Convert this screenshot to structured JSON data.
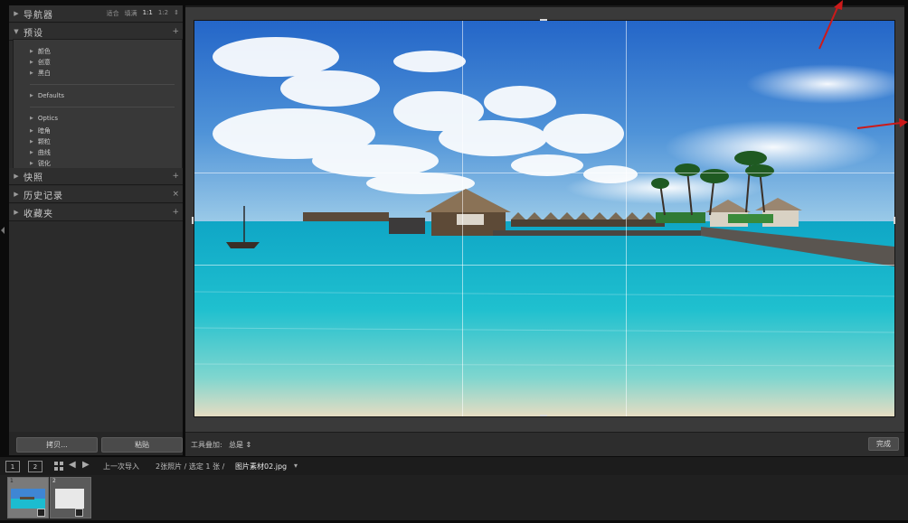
{
  "left_panel": {
    "navigator": {
      "title": "导航器",
      "options": [
        "适合",
        "填满",
        "1:1",
        "1:2"
      ],
      "selected": "1:1",
      "toggle": "⇕"
    },
    "presets": {
      "title": "预设",
      "add": "+",
      "group1": [
        "颜色",
        "创意",
        "黑白"
      ],
      "group2": [
        "Defaults"
      ],
      "group3": [
        "Optics",
        "暗角",
        "颗粒",
        "曲线",
        "锐化"
      ]
    },
    "snapshots": {
      "title": "快照",
      "add": "+"
    },
    "history": {
      "title": "历史记录",
      "clear": "×"
    },
    "collections": {
      "title": "收藏夹",
      "add": "+"
    },
    "copy_button": "拷贝...",
    "paste_button": "粘贴"
  },
  "toolbar": {
    "overlay_label": "工具叠加:",
    "overlay_value": "总是",
    "done_button": "完成"
  },
  "filmstrip_bar": {
    "views": [
      "1",
      "2"
    ],
    "source": "上一次导入",
    "info": "2张照片 / 选定 1 张 /",
    "filename": "图片素材02.jpg",
    "dropdown": "▾"
  },
  "filmstrip": {
    "thumbs": [
      "1",
      "2"
    ]
  },
  "colors": {
    "annotation_arrow": "#cc1a1a",
    "panel_bg": "#2b2b2b",
    "photo_sea": "#19b9cf",
    "photo_sky": "#2f78d0"
  },
  "icons": [
    "grid-icon",
    "back-arrow-icon",
    "forward-arrow-icon",
    "triangle-icon",
    "plus-icon",
    "close-icon"
  ]
}
